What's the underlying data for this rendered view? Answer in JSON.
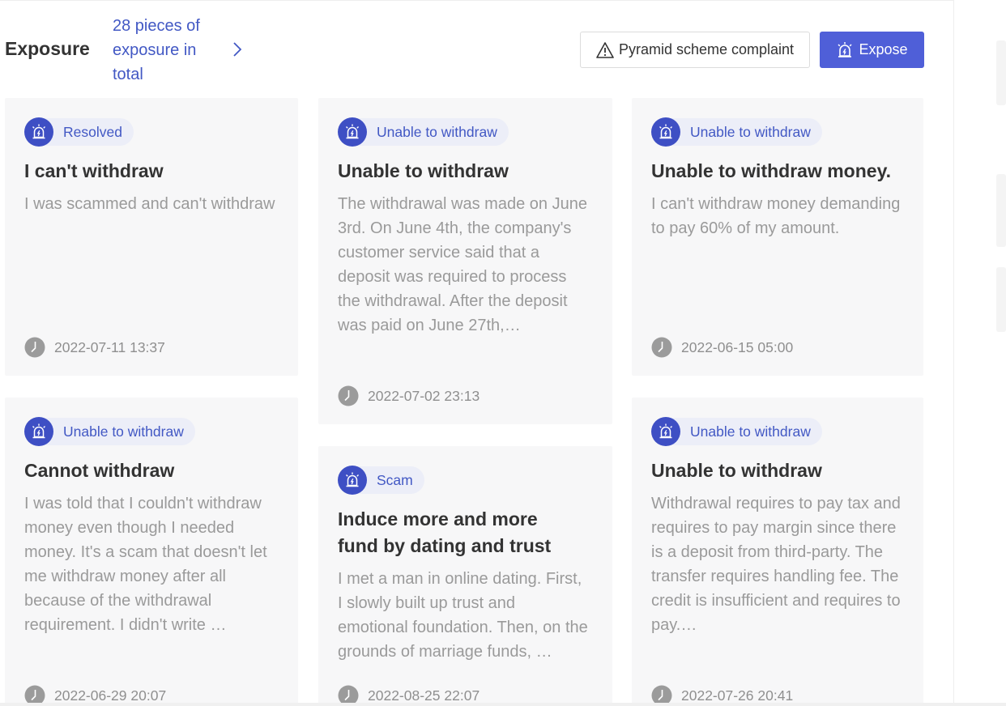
{
  "header": {
    "title": "Exposure",
    "count_text": "28 pieces of exposure in total",
    "complaint_button": "Pyramid scheme complaint",
    "expose_button": "Expose"
  },
  "colors": {
    "accent": "#4f5fd8",
    "badge_bg": "#3e4fc4",
    "link": "#4258c4",
    "card_bg": "#f7f7f8"
  },
  "cards": [
    {
      "tag": "Resolved",
      "title": "I can't withdraw",
      "description": "I was scammed and can't withdraw",
      "time": "2022-07-11 13:37"
    },
    {
      "tag": "Unable to withdraw",
      "title": "Unable to withdraw",
      "description": "The withdrawal was made on June 3rd. On June 4th, the company's customer service said that a deposit was required to process the withdrawal. After the deposit was paid on June 27th,…",
      "time": "2022-07-02 23:13"
    },
    {
      "tag": "Unable to withdraw",
      "title": "Unable to withdraw money.",
      "description": "I can't withdraw money demanding to pay 60% of my amount.",
      "time": "2022-06-15 05:00"
    },
    {
      "tag": "Unable to withdraw",
      "title": "Cannot withdraw",
      "description": "I was told that I couldn't withdraw money even though I needed money. It's a scam that doesn't let me withdraw money after all because of the withdrawal requirement. I didn't write …",
      "time": "2022-06-29 20:07"
    },
    {
      "tag": "Scam",
      "title": "Induce more and more fund by dating and trust",
      "description": "I met a man in online dating. First, I slowly built up trust and emotional foundation. Then, on the grounds of marriage funds, …",
      "time": "2022-08-25 22:07"
    },
    {
      "tag": "Unable to withdraw",
      "title": "Unable to withdraw",
      "description": "Withdrawal requires to pay tax and requires to pay margin since there is a deposit from third-party. The transfer requires handling fee. The credit is insufficient and requires to pay.…",
      "time": "2022-07-26 20:41"
    }
  ]
}
